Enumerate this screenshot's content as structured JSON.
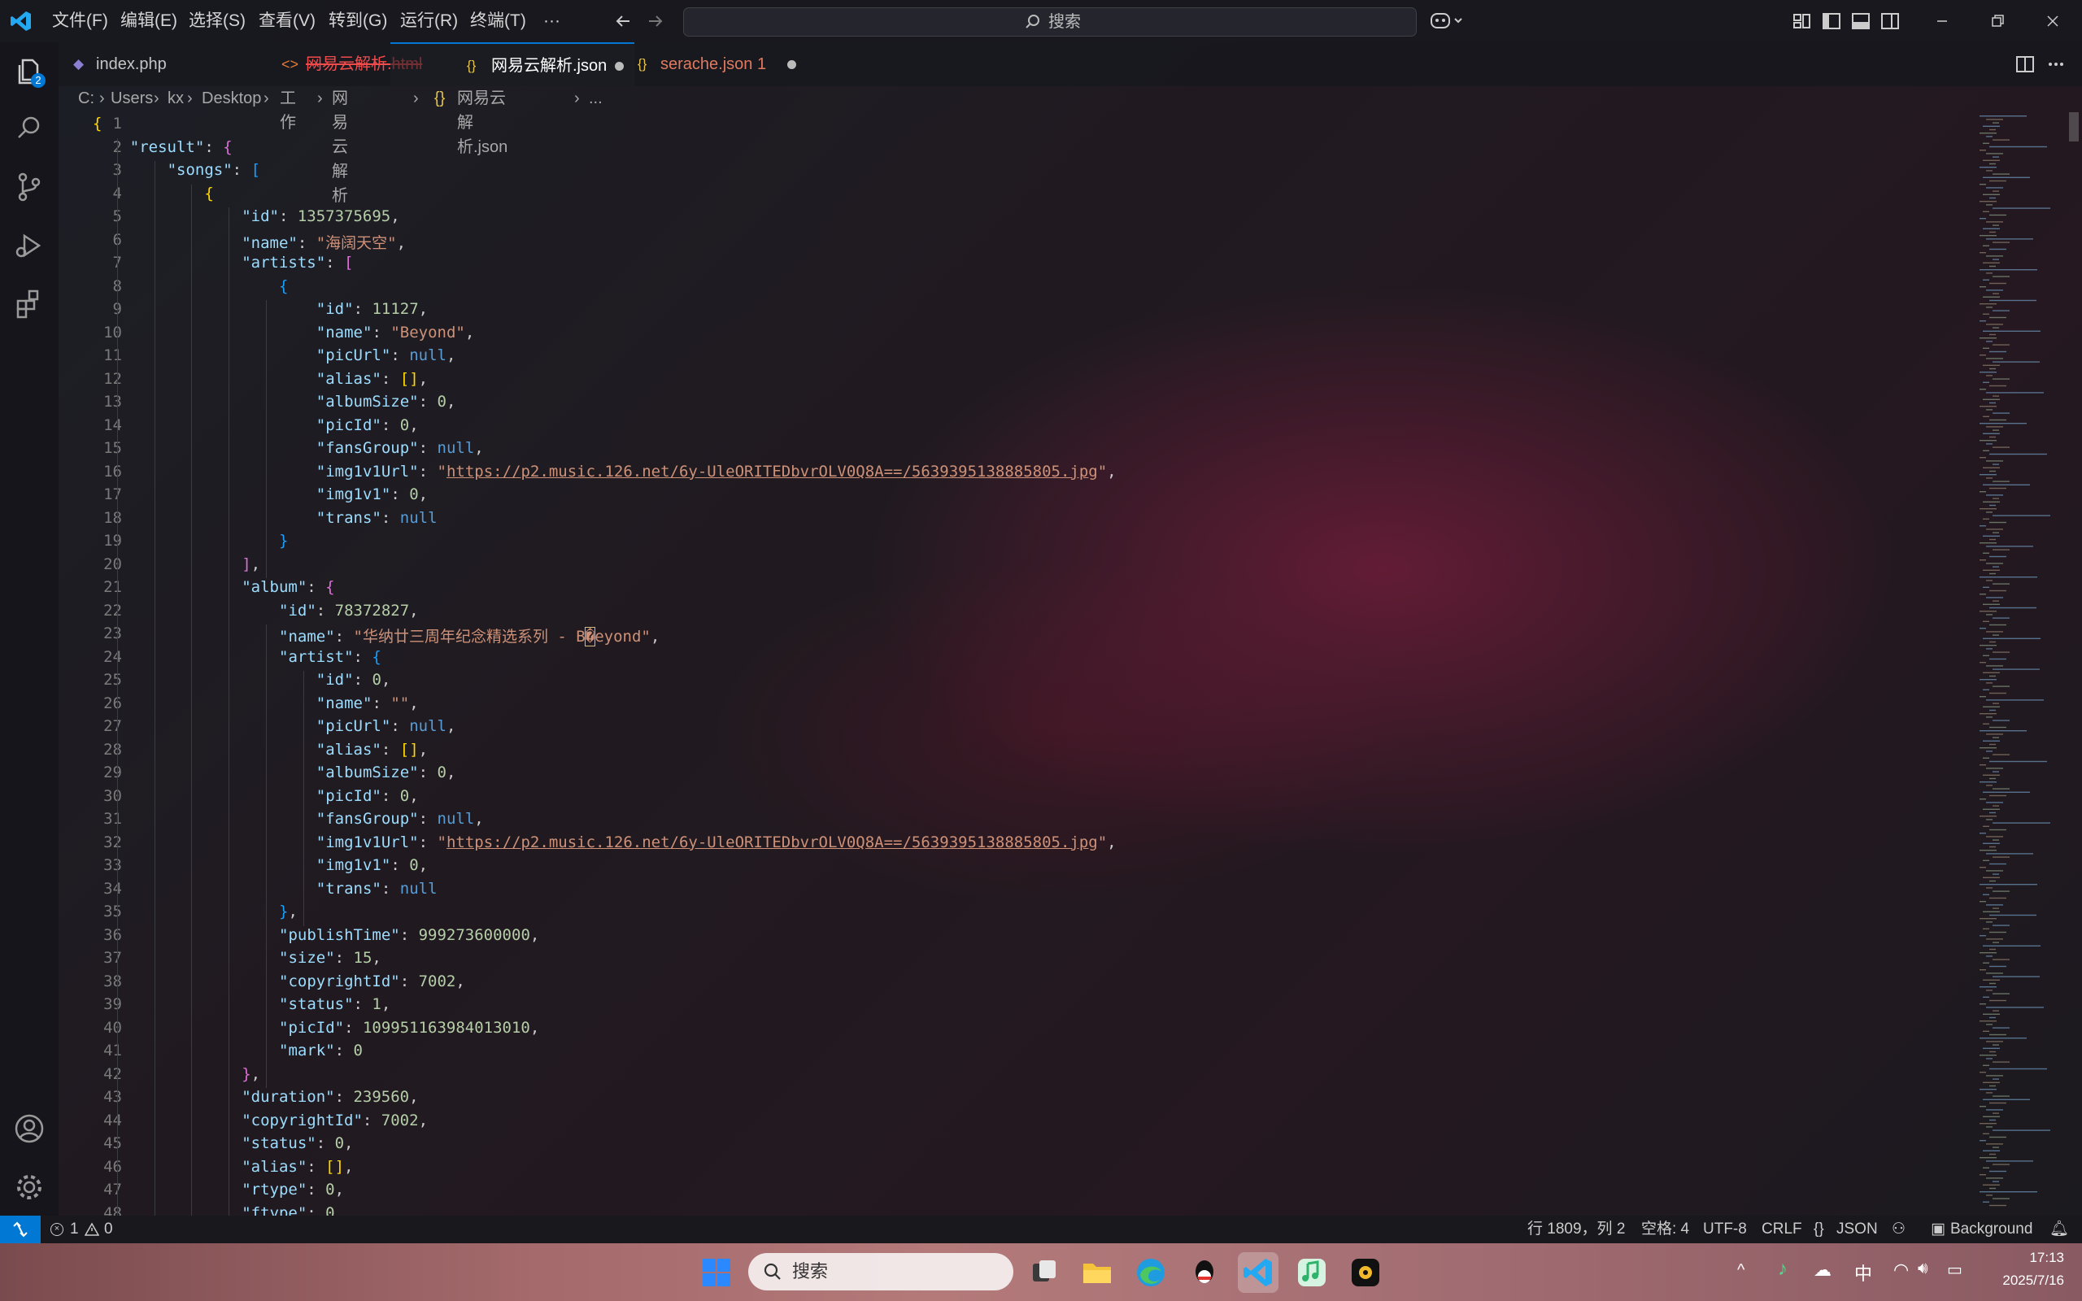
{
  "titlebar": {
    "menu": [
      "文件(F)",
      "编辑(E)",
      "选择(S)",
      "查看(V)",
      "转到(G)",
      "运行(R)",
      "终端(T)",
      "···"
    ],
    "search_label": "搜索"
  },
  "activity": {
    "explorer_badge": "2"
  },
  "tabs": [
    {
      "label": "index.php",
      "color": "#c5c5c5"
    },
    {
      "label": "网易云解析.html",
      "color": "#f14c4c"
    },
    {
      "label": "网易云解析.json",
      "color": "#ffffff"
    },
    {
      "label": "serache.json 1",
      "color": "#e07a5f"
    }
  ],
  "breadcrumb": {
    "parts": [
      "C:",
      "Users",
      "kx",
      "Desktop",
      "工作",
      "网易云解析"
    ],
    "file": "网易云解析.json",
    "tail": "..."
  },
  "code": {
    "l1": [
      "{"
    ],
    "l2": [
      "\"result\"",
      ": ",
      "{"
    ],
    "l3": [
      "\"songs\"",
      ": ",
      "["
    ],
    "l4": [
      "{"
    ],
    "l5": [
      "\"id\"",
      ": ",
      "1357375695",
      ","
    ],
    "l6": [
      "\"name\"",
      ": ",
      "\"海阔天空\"",
      ","
    ],
    "l7": [
      "\"artists\"",
      ": ",
      "["
    ],
    "l8": [
      "{"
    ],
    "l9": [
      "\"id\"",
      ": ",
      "11127",
      ","
    ],
    "l10": [
      "\"name\"",
      ": ",
      "\"Beyond\"",
      ","
    ],
    "l11": [
      "\"picUrl\"",
      ": ",
      "null",
      ","
    ],
    "l12": [
      "\"alias\"",
      ": ",
      "[]",
      ","
    ],
    "l13": [
      "\"albumSize\"",
      ": ",
      "0",
      ","
    ],
    "l14": [
      "\"picId\"",
      ": ",
      "0",
      ","
    ],
    "l15": [
      "\"fansGroup\"",
      ": ",
      "null",
      ","
    ],
    "l16": [
      "\"img1v1Url\"",
      ": ",
      "\"",
      "https://p2.music.126.net/6y-UleORITEDbvrOLV0Q8A==/5639395138885805.jpg",
      "\"",
      ","
    ],
    "l17": [
      "\"img1v1\"",
      ": ",
      "0",
      ","
    ],
    "l18": [
      "\"trans\"",
      ": ",
      "null"
    ],
    "l19": [
      "}"
    ],
    "l20": [
      "]",
      ","
    ],
    "l21": [
      "\"album\"",
      ": ",
      "{"
    ],
    "l22": [
      "\"id\"",
      ": ",
      "78372827",
      ","
    ],
    "l23": [
      "\"name\"",
      ": ",
      "\"华纳廿三周年纪念精选系列 - B",
      "�",
      "eyond\"",
      ","
    ],
    "l24": [
      "\"artist\"",
      ": ",
      "{"
    ],
    "l25": [
      "\"id\"",
      ": ",
      "0",
      ","
    ],
    "l26": [
      "\"name\"",
      ": ",
      "\"\"",
      ","
    ],
    "l27": [
      "\"picUrl\"",
      ": ",
      "null",
      ","
    ],
    "l28": [
      "\"alias\"",
      ": ",
      "[]",
      ","
    ],
    "l29": [
      "\"albumSize\"",
      ": ",
      "0",
      ","
    ],
    "l30": [
      "\"picId\"",
      ": ",
      "0",
      ","
    ],
    "l31": [
      "\"fansGroup\"",
      ": ",
      "null",
      ","
    ],
    "l32": [
      "\"img1v1Url\"",
      ": ",
      "\"",
      "https://p2.music.126.net/6y-UleORITEDbvrOLV0Q8A==/5639395138885805.jpg",
      "\"",
      ","
    ],
    "l33": [
      "\"img1v1\"",
      ": ",
      "0",
      ","
    ],
    "l34": [
      "\"trans\"",
      ": ",
      "null"
    ],
    "l35": [
      "}",
      ","
    ],
    "l36": [
      "\"publishTime\"",
      ": ",
      "999273600000",
      ","
    ],
    "l37": [
      "\"size\"",
      ": ",
      "15",
      ","
    ],
    "l38": [
      "\"copyrightId\"",
      ": ",
      "7002",
      ","
    ],
    "l39": [
      "\"status\"",
      ": ",
      "1",
      ","
    ],
    "l40": [
      "\"picId\"",
      ": ",
      "109951163984013010",
      ","
    ],
    "l41": [
      "\"mark\"",
      ": ",
      "0"
    ],
    "l42": [
      "}",
      ","
    ],
    "l43": [
      "\"duration\"",
      ": ",
      "239560",
      ","
    ],
    "l44": [
      "\"copyrightId\"",
      ": ",
      "7002",
      ","
    ],
    "l45": [
      "\"status\"",
      ": ",
      "0",
      ","
    ],
    "l46": [
      "\"alias\"",
      ": ",
      "[]",
      ","
    ],
    "l47": [
      "\"rtype\"",
      ": ",
      "0",
      ","
    ],
    "l48": [
      "\"ftype\"",
      ": ",
      "0"
    ]
  },
  "line_numbers": [
    "1",
    "2",
    "3",
    "4",
    "5",
    "6",
    "7",
    "8",
    "9",
    "10",
    "11",
    "12",
    "13",
    "14",
    "15",
    "16",
    "17",
    "18",
    "19",
    "20",
    "21",
    "22",
    "23",
    "24",
    "25",
    "26",
    "27",
    "28",
    "29",
    "30",
    "31",
    "32",
    "33",
    "34",
    "35",
    "36",
    "37",
    "38",
    "39",
    "40",
    "41",
    "42",
    "43",
    "44",
    "45",
    "46",
    "47",
    "48"
  ],
  "status": {
    "errors": "1",
    "warnings": "0",
    "position": "行 1809，列 2",
    "spaces": "空格: 4",
    "encoding": "UTF-8",
    "eol": "CRLF",
    "language": "JSON",
    "background": "Background"
  },
  "taskbar": {
    "search_label": "搜索",
    "ime": "中",
    "time": "17:13",
    "date": "2025/7/16"
  }
}
